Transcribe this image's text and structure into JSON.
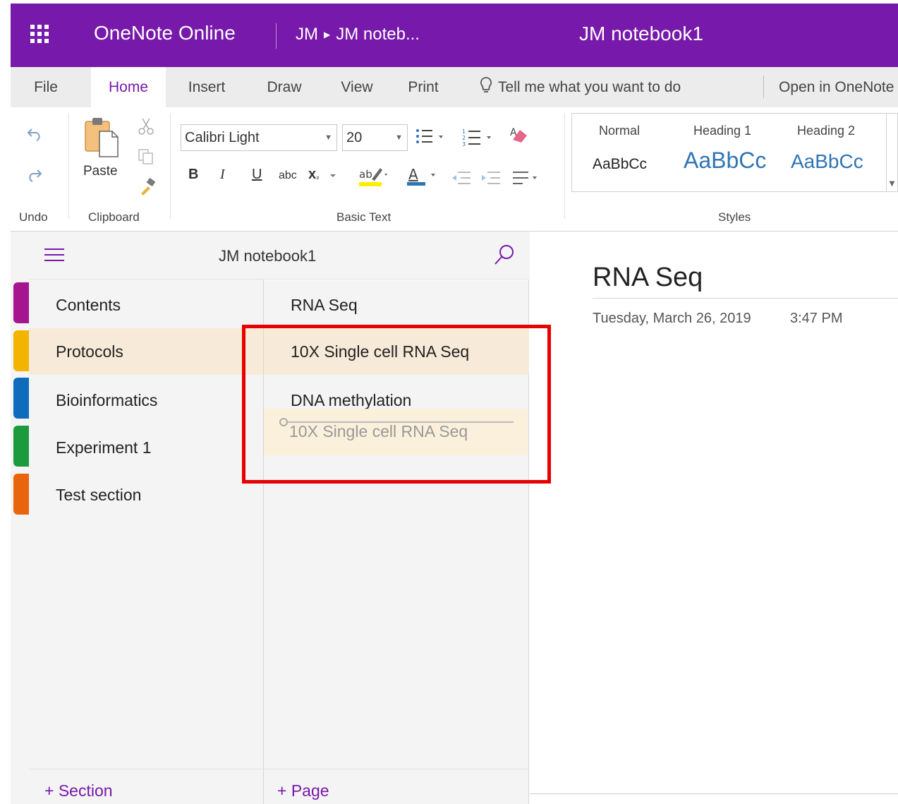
{
  "titlebar": {
    "app_name": "OneNote Online",
    "breadcrumb_user": "JM",
    "breadcrumb_notebook": "JM noteb...",
    "document_title": "JM notebook1",
    "accent_color": "#7719aa"
  },
  "menu_tabs": {
    "file": "File",
    "home": "Home",
    "insert": "Insert",
    "draw": "Draw",
    "view": "View",
    "print": "Print",
    "tell_me": "Tell me what you want to do",
    "open_in": "Open in OneNote"
  },
  "ribbon": {
    "paste_label": "Paste",
    "font_name": "Calibri Light",
    "font_size": "20",
    "bold": "B",
    "italic": "I",
    "underline": "U",
    "strikethrough": "abc",
    "subscript": "x",
    "groups": {
      "undo": "Undo",
      "clipboard": "Clipboard",
      "basic_text": "Basic Text",
      "styles": "Styles"
    },
    "styles": [
      {
        "name": "Normal",
        "sample": "AaBbCc"
      },
      {
        "name": "Heading 1",
        "sample": "AaBbCc"
      },
      {
        "name": "Heading 2",
        "sample": "AaBbCc"
      }
    ]
  },
  "navigation": {
    "notebook_name": "JM notebook1",
    "sections": [
      {
        "label": "Contents",
        "color": "#a4158f"
      },
      {
        "label": "Protocols",
        "color": "#f2b400"
      },
      {
        "label": "Bioinformatics",
        "color": "#0f6cbd"
      },
      {
        "label": "Experiment 1",
        "color": "#1b9a3e"
      },
      {
        "label": "Test section",
        "color": "#e8650d"
      }
    ],
    "selected_section": "Protocols",
    "pages": [
      {
        "label": "RNA Seq"
      },
      {
        "label": "10X Single cell RNA Seq"
      },
      {
        "label": "DNA methylation"
      }
    ],
    "dragging_page": "10X Single cell RNA Seq",
    "add_section": "+ Section",
    "add_page": "+ Page"
  },
  "page": {
    "title": "RNA Seq",
    "date": "Tuesday, March 26, 2019",
    "time": "3:47 PM"
  },
  "annotation": {
    "highlight_color": "#e60000"
  }
}
